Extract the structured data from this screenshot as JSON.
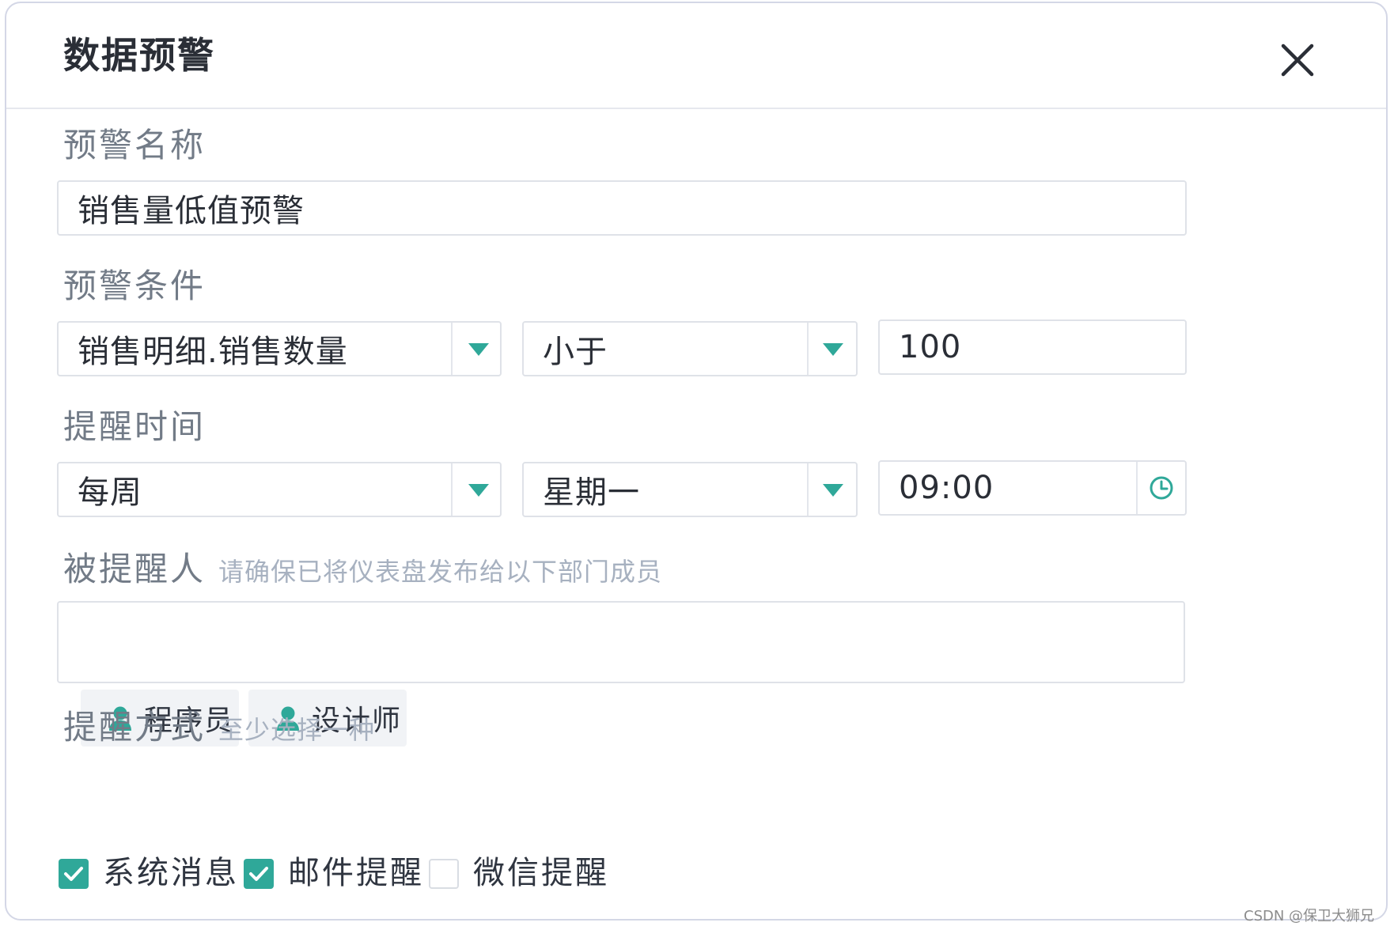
{
  "dialog": {
    "title": "数据预警"
  },
  "alert_name": {
    "label": "预警名称",
    "value": "销售量低值预警"
  },
  "condition": {
    "label": "预警条件",
    "field": "销售明细.销售数量",
    "operator": "小于",
    "threshold": "100"
  },
  "schedule": {
    "label": "提醒时间",
    "frequency": "每周",
    "day": "星期一",
    "time": "09:00"
  },
  "recipients": {
    "label": "被提醒人",
    "hint": "请确保已将仪表盘发布给以下部门成员",
    "items": [
      {
        "label": "程序员"
      },
      {
        "label": "设计师"
      }
    ]
  },
  "methods": {
    "label": "提醒方式",
    "hint": "至少选择一种",
    "options": [
      {
        "label": "系统消息",
        "checked": true
      },
      {
        "label": "邮件提醒",
        "checked": true
      },
      {
        "label": "微信提醒",
        "checked": false
      }
    ]
  },
  "colors": {
    "accent": "#2fa899",
    "title": "#2a2e36",
    "label": "#727b87",
    "hint": "#a7b1c0",
    "border": "#dfe2e8"
  },
  "watermark": "CSDN @保卫大狮兄"
}
